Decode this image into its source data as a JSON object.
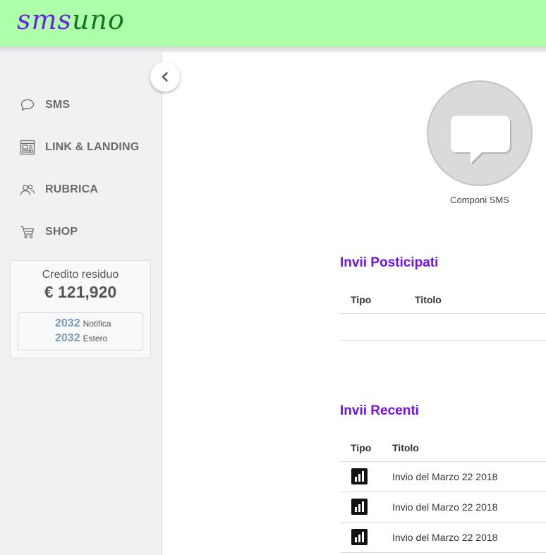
{
  "brand": {
    "part1": "sms",
    "part2": "uno"
  },
  "sidebar": {
    "items": [
      {
        "label": "SMS",
        "icon": "chat-bubble-icon"
      },
      {
        "label": "LINK & LANDING",
        "icon": "landing-page-icon"
      },
      {
        "label": "RUBRICA",
        "icon": "contacts-icon"
      },
      {
        "label": "SHOP",
        "icon": "cart-icon"
      }
    ],
    "credit": {
      "title": "Credito residuo",
      "value": "€ 121,920",
      "rows": [
        {
          "count": "2032",
          "label": "Notifica"
        },
        {
          "count": "2032",
          "label": "Estero"
        }
      ]
    }
  },
  "main": {
    "compose_label": "Componi SMS",
    "scheduled": {
      "title": "Invii Posticipati",
      "columns": [
        "Tipo",
        "Titolo"
      ]
    },
    "recent": {
      "title": "Invii Recenti",
      "columns": [
        "Tipo",
        "Titolo"
      ],
      "rows": [
        {
          "title": "Invio del Marzo 22 2018",
          "icon": "stats-icon"
        },
        {
          "title": "Invio del Marzo 22 2018",
          "icon": "stats-icon"
        },
        {
          "title": "Invio del Marzo 22 2018",
          "icon": "stats-icon"
        }
      ]
    }
  },
  "colors": {
    "header_bg": "#adffa9",
    "accent": "#7011e8",
    "logo_purple": "#6a23e6",
    "logo_green": "#12781c"
  }
}
